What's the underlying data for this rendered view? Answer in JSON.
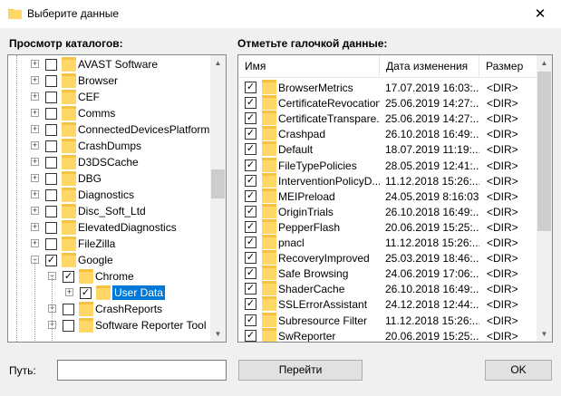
{
  "window": {
    "title": "Выберите данные",
    "close_glyph": "✕"
  },
  "tree_panel": {
    "label": "Просмотр каталогов:",
    "items": [
      {
        "label": "AVAST Software",
        "level": 1,
        "checked": false,
        "expandable": true
      },
      {
        "label": "Browser",
        "level": 1,
        "checked": false,
        "expandable": true
      },
      {
        "label": "CEF",
        "level": 1,
        "checked": false,
        "expandable": true
      },
      {
        "label": "Comms",
        "level": 1,
        "checked": false,
        "expandable": true
      },
      {
        "label": "ConnectedDevicesPlatform",
        "level": 1,
        "checked": false,
        "expandable": true
      },
      {
        "label": "CrashDumps",
        "level": 1,
        "checked": false,
        "expandable": true
      },
      {
        "label": "D3DSCache",
        "level": 1,
        "checked": false,
        "expandable": true
      },
      {
        "label": "DBG",
        "level": 1,
        "checked": false,
        "expandable": true
      },
      {
        "label": "Diagnostics",
        "level": 1,
        "checked": false,
        "expandable": true
      },
      {
        "label": "Disc_Soft_Ltd",
        "level": 1,
        "checked": false,
        "expandable": true
      },
      {
        "label": "ElevatedDiagnostics",
        "level": 1,
        "checked": false,
        "expandable": true
      },
      {
        "label": "FileZilla",
        "level": 1,
        "checked": false,
        "expandable": true
      },
      {
        "label": "Google",
        "level": 1,
        "checked": true,
        "expanded": true
      },
      {
        "label": "Chrome",
        "level": 2,
        "checked": true,
        "expanded": true
      },
      {
        "label": "User Data",
        "level": 3,
        "checked": true,
        "expandable": true,
        "selected": true
      },
      {
        "label": "CrashReports",
        "level": 2,
        "checked": false,
        "expandable": true
      },
      {
        "label": "Software Reporter Tool",
        "level": 2,
        "checked": false,
        "expandable": true
      }
    ]
  },
  "list_panel": {
    "label": "Отметьте галочкой данные:",
    "columns": {
      "name": "Имя",
      "date": "Дата изменения",
      "size": "Размер"
    },
    "rows": [
      {
        "name": "BrowserMetrics",
        "date": "17.07.2019 16:03:...",
        "size": "<DIR>",
        "checked": true
      },
      {
        "name": "CertificateRevocation",
        "date": "25.06.2019 14:27:...",
        "size": "<DIR>",
        "checked": true
      },
      {
        "name": "CertificateTranspare...",
        "date": "25.06.2019 14:27:...",
        "size": "<DIR>",
        "checked": true
      },
      {
        "name": "Crashpad",
        "date": "26.10.2018 16:49:...",
        "size": "<DIR>",
        "checked": true
      },
      {
        "name": "Default",
        "date": "18.07.2019 11:19:...",
        "size": "<DIR>",
        "checked": true
      },
      {
        "name": "FileTypePolicies",
        "date": "28.05.2019 12:41:...",
        "size": "<DIR>",
        "checked": true
      },
      {
        "name": "InterventionPolicyD...",
        "date": "11.12.2018 15:26:...",
        "size": "<DIR>",
        "checked": true
      },
      {
        "name": "MEIPreload",
        "date": "24.05.2019 8:16:03",
        "size": "<DIR>",
        "checked": true
      },
      {
        "name": "OriginTrials",
        "date": "26.10.2018 16:49:...",
        "size": "<DIR>",
        "checked": true
      },
      {
        "name": "PepperFlash",
        "date": "20.06.2019 15:25:...",
        "size": "<DIR>",
        "checked": true
      },
      {
        "name": "pnacl",
        "date": "11.12.2018 15:26:...",
        "size": "<DIR>",
        "checked": true
      },
      {
        "name": "RecoveryImproved",
        "date": "25.03.2019 18:46:...",
        "size": "<DIR>",
        "checked": true
      },
      {
        "name": "Safe Browsing",
        "date": "24.06.2019 17:06:...",
        "size": "<DIR>",
        "checked": true
      },
      {
        "name": "ShaderCache",
        "date": "26.10.2018 16:49:...",
        "size": "<DIR>",
        "checked": true
      },
      {
        "name": "SSLErrorAssistant",
        "date": "24.12.2018 12:44:...",
        "size": "<DIR>",
        "checked": true
      },
      {
        "name": "Subresource Filter",
        "date": "11.12.2018 15:26:...",
        "size": "<DIR>",
        "checked": true
      },
      {
        "name": "SwReporter",
        "date": "20.06.2019 15:25:...",
        "size": "<DIR>",
        "checked": true
      }
    ]
  },
  "footer": {
    "path_label": "Путь:",
    "path_value": "",
    "go_button": "Перейти",
    "ok_button": "OK"
  },
  "colors": {
    "accent": "#0078d7",
    "folder": "#ffd766",
    "folder_tab": "#f5c241",
    "background": "#f0f0f0"
  },
  "icons": {
    "folder": "folder-icon",
    "check": "checkmark-icon",
    "expand": "expand-plus-icon",
    "collapse": "collapse-minus-icon"
  }
}
